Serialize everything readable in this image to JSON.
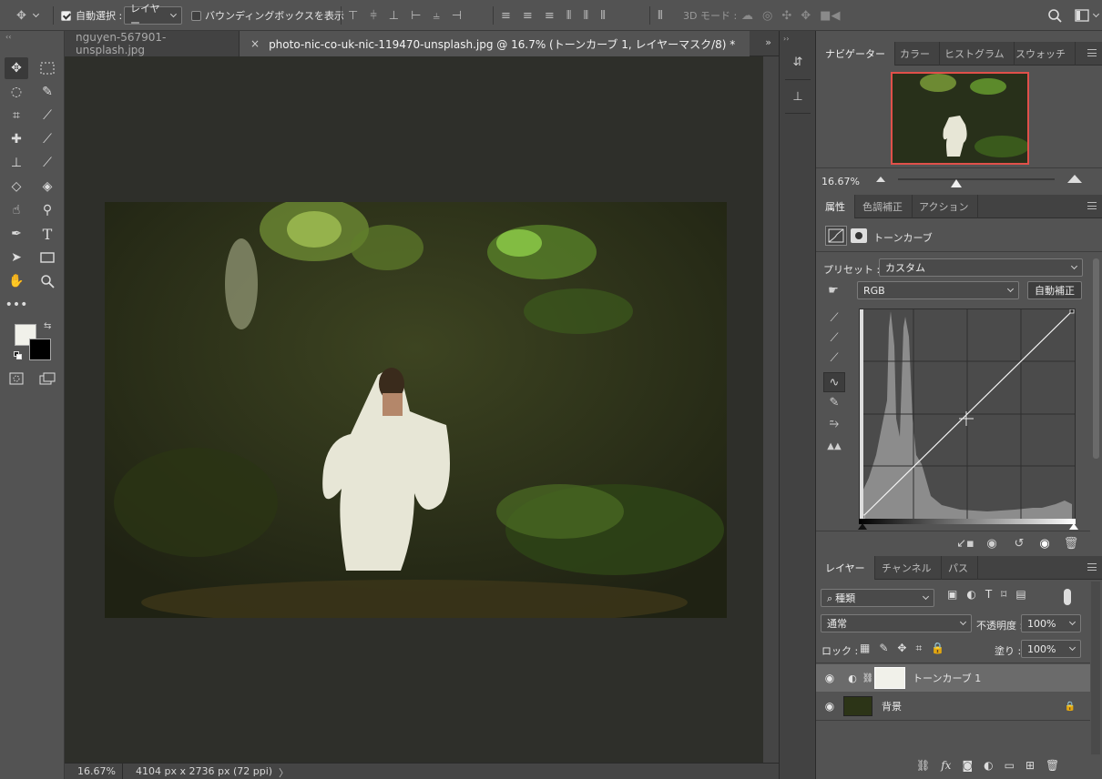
{
  "optbar": {
    "auto_select_label": "自動選択 :",
    "auto_select_value": "レイヤー",
    "bounding_box_label": "バウンディングボックスを表示",
    "mode3d_label": "3D モード :"
  },
  "tabs": [
    {
      "label": "nguyen-567901-unsplash.jpg"
    },
    {
      "close": "×",
      "label": "photo-nic-co-uk-nic-119470-unsplash.jpg @ 16.7% (トーンカーブ 1, レイヤーマスク/8) *"
    }
  ],
  "status": {
    "zoom": "16.67%",
    "doc_size": "4104 px x 2736 px (72 ppi)",
    "arrow": "〉"
  },
  "navigator": {
    "tabs": [
      "ナビゲーター",
      "カラー",
      "ヒストグラム",
      "スウォッチ"
    ],
    "zoom": "16.67%"
  },
  "properties": {
    "tabs": [
      "属性",
      "色調補正",
      "アクション"
    ],
    "title": "トーンカーブ",
    "preset_label": "プリセット :",
    "preset_value": "カスタム",
    "channel_value": "RGB",
    "auto_button": "自動補正"
  },
  "layers": {
    "tabs": [
      "レイヤー",
      "チャンネル",
      "パス"
    ],
    "filter_value": "種類",
    "blend_mode": "通常",
    "opacity_label": "不透明度 :",
    "opacity_value": "100%",
    "lock_label": "ロック :",
    "fill_label": "塗り :",
    "fill_value": "100%",
    "items": [
      {
        "name": "トーンカーブ 1",
        "selected": true
      },
      {
        "name": "背景",
        "selected": false
      }
    ]
  },
  "colors": {
    "accent_red": "#e0504a",
    "panel_bg": "#535353",
    "dark_bg": "#424242"
  }
}
